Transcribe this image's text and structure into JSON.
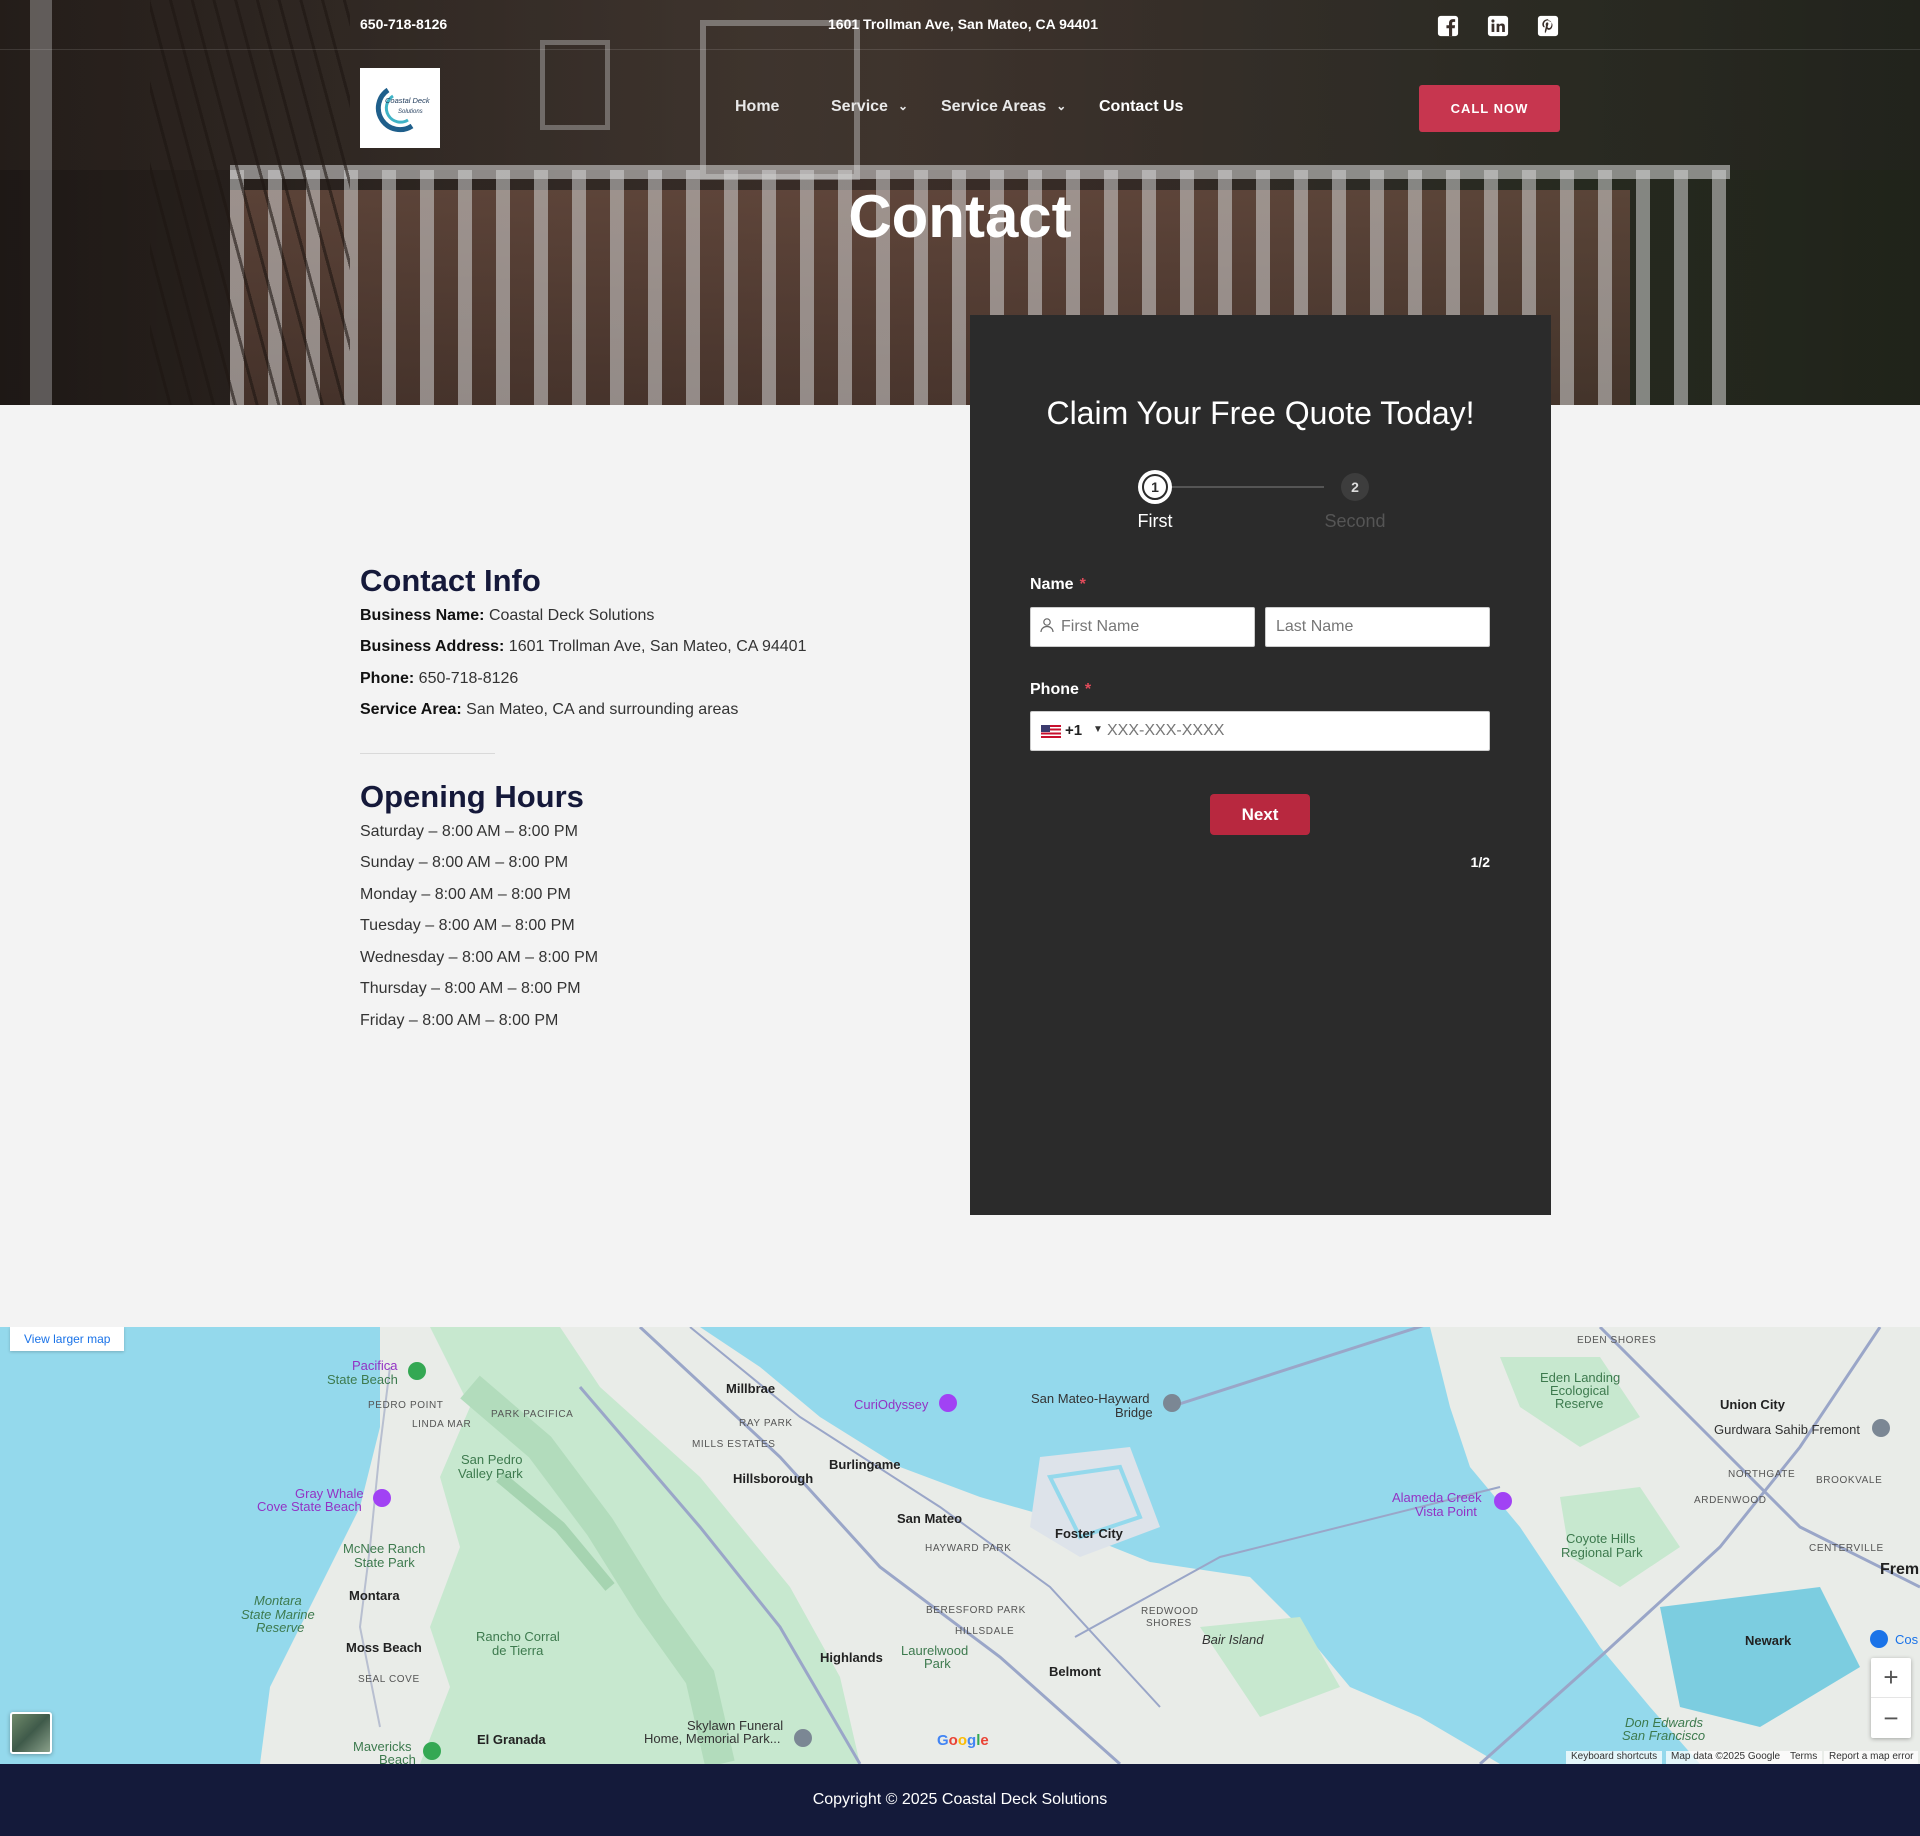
{
  "topbar": {
    "phone": "650-718-8126",
    "address": "1601 Trollman Ave, San Mateo, CA 94401",
    "social_icons": [
      "facebook-icon",
      "linkedin-icon",
      "pinterest-icon"
    ]
  },
  "logo": {
    "line1": "Coastal Deck",
    "line2": "Solutions"
  },
  "nav": {
    "items": [
      {
        "label": "Home",
        "dropdown": false
      },
      {
        "label": "Service",
        "dropdown": true
      },
      {
        "label": "Service Areas",
        "dropdown": true
      },
      {
        "label": "Contact Us",
        "dropdown": false
      }
    ],
    "cta": "CALL NOW"
  },
  "hero": {
    "title": "Contact"
  },
  "contact_info": {
    "title": "Contact Info",
    "business_name_label": "Business Name:",
    "business_name": "Coastal Deck Solutions",
    "business_address_label": "Business Address:",
    "business_address": "1601 Trollman Ave, San Mateo, CA 94401",
    "phone_label": "Phone:",
    "phone": "650-718-8126",
    "service_area_label": "Service Area:",
    "service_area": "San Mateo, CA and surrounding areas"
  },
  "opening_hours": {
    "title": "Opening Hours",
    "days": [
      "Saturday – 8:00 AM – 8:00 PM",
      "Sunday – 8:00 AM – 8:00 PM",
      "Monday – 8:00 AM – 8:00 PM",
      "Tuesday – 8:00 AM – 8:00 PM",
      "Wednesday – 8:00 AM – 8:00 PM",
      "Thursday – 8:00 AM – 8:00 PM",
      "Friday – 8:00 AM – 8:00 PM"
    ]
  },
  "form": {
    "title": "Claim Your Free Quote Today!",
    "steps": [
      {
        "number": "1",
        "label": "First"
      },
      {
        "number": "2",
        "label": "Second"
      }
    ],
    "name_label": "Name",
    "required_mark": "*",
    "first_name_placeholder": "First Name",
    "last_name_placeholder": "Last Name",
    "phone_label": "Phone",
    "dial_code": "+1",
    "phone_placeholder": "XXX-XXX-XXXX",
    "next_label": "Next",
    "step_count": "1/2",
    "colors": {
      "card": "#2b2b2b",
      "button": "#b8283f",
      "required": "#e14b5a"
    }
  },
  "map": {
    "view_larger": "View larger map",
    "zoom_in": "+",
    "zoom_out": "−",
    "google_logo": [
      "G",
      "o",
      "o",
      "g",
      "l",
      "e"
    ],
    "attribution": [
      "Keyboard shortcuts",
      "Map data ©2025 Google",
      "Terms",
      "Report a map error"
    ],
    "labels": {
      "pacifica": "Pacifica",
      "pacifica_beach": "State Beach",
      "pedro_point": "PEDRO POINT",
      "linda_mar": "LINDA MAR",
      "park_pacifica": "PARK PACIFICA",
      "millbrae": "Millbrae",
      "curiodyssey": "CuriOdyssey",
      "bridge1": "San Mateo-Hayward",
      "bridge2": "Bridge",
      "eden_shores": "EDEN SHORES",
      "eden1": "Eden Landing",
      "eden2": "Ecological",
      "eden3": "Reserve",
      "union_city": "Union City",
      "gurdwara": "Gurdwara Sahib Fremont",
      "ray_park": "RAY PARK",
      "mills_estates": "MILLS ESTATES",
      "burlingame": "Burlingame",
      "hillsborough": "Hillsborough",
      "san_pedro1": "San Pedro",
      "san_pedro2": "Valley Park",
      "gray_whale1": "Gray Whale",
      "gray_whale2": "Cove State Beach",
      "northgate": "NORTHGATE",
      "ardenwood": "ARDENWOOD",
      "brookvale": "BROOKVALE",
      "alameda1": "Alameda Creek",
      "alameda2": "Vista Point",
      "san_mateo": "San Mateo",
      "foster_city": "Foster City",
      "mcnee1": "McNee Ranch",
      "mcnee2": "State Park",
      "hayward_park": "HAYWARD PARK",
      "coyote1": "Coyote Hills",
      "coyote2": "Regional Park",
      "centerville": "CENTERVILLE",
      "fremont": "Frem",
      "montara": "Montara",
      "montara_res1": "Montara",
      "montara_res2": "State Marine",
      "montara_res3": "Reserve",
      "beresford": "BERESFORD PARK",
      "redwood1": "REDWOOD",
      "redwood2": "SHORES",
      "hillsdale": "HILLSDALE",
      "bair": "Bair Island",
      "rancho1": "Rancho Corral",
      "rancho2": "de Tierra",
      "newark": "Newark",
      "moss_beach": "Moss Beach",
      "highlands": "Highlands",
      "laurelwood1": "Laurelwood",
      "laurelwood2": "Park",
      "belmont": "Belmont",
      "seal_cove": "SEAL COVE",
      "cos": "Cos",
      "skylawn1": "Skylawn Funeral",
      "skylawn2": "Home, Memorial Park...",
      "don1": "Don Edwards",
      "don2": "San Francisco",
      "mavericks1": "Mavericks",
      "mavericks2": "Beach",
      "el_granada": "El Granada"
    }
  },
  "footer": {
    "copyright": "Copyright © 2025 Coastal Deck Solutions"
  }
}
